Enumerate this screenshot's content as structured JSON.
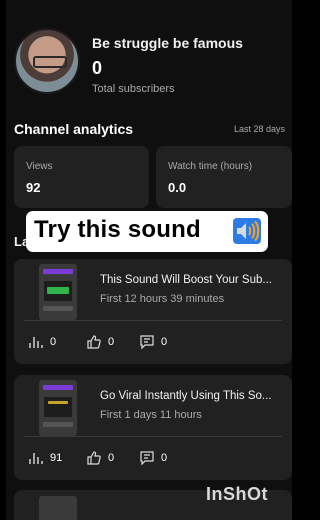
{
  "channel": {
    "name": "Be struggle be famous",
    "subscribers": "0",
    "subscribers_label": "Total subscribers"
  },
  "analytics": {
    "title": "Channel analytics",
    "period": "Last 28 days",
    "views_label": "Views",
    "views_value": "92",
    "watch_label": "Watch time (hours)",
    "watch_value": "0.0",
    "section_heading_fragment": "La"
  },
  "overlay": {
    "text": "Try this sound",
    "icon": "speaker-icon"
  },
  "videos": [
    {
      "title": "This Sound Will Boost Your Sub...",
      "subtitle": "First 12 hours 39 minutes",
      "views": "0",
      "likes": "0",
      "comments": "0"
    },
    {
      "title": "Go Viral Instantly Using This So...",
      "subtitle": "First 1 days 11 hours",
      "views": "91",
      "likes": "0",
      "comments": "0"
    }
  ],
  "watermark": "InShOt",
  "colors": {
    "background": "#0f0f0f",
    "card": "#212121",
    "muted_text": "#aaaaaa",
    "speaker_blue": "#2e7be3",
    "speaker_orange": "#f5a623"
  }
}
